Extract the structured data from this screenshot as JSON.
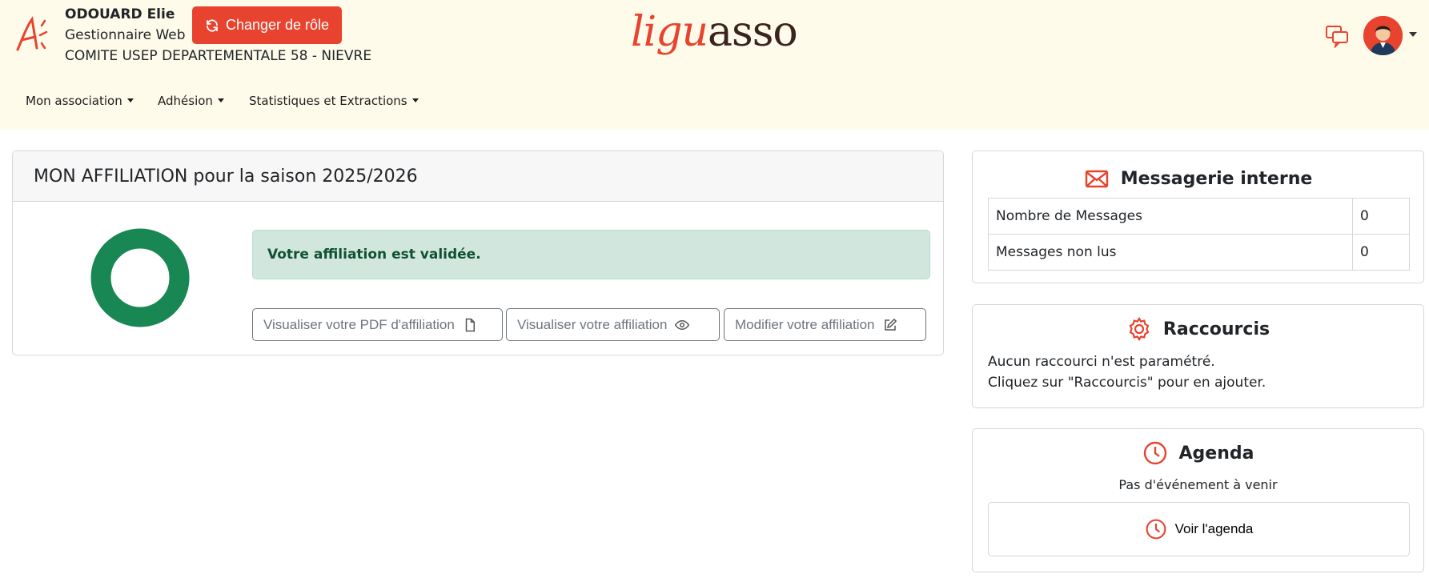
{
  "user": {
    "name": "ODOUARD Elie",
    "role": "Gestionnaire Web",
    "organization": "COMITE USEP DEPARTEMENTALE 58 - NIEVRE"
  },
  "header": {
    "change_role_label": "Changer de rôle",
    "brand_part1": "ligu",
    "brand_part2": "asso",
    "chat_icon": "chat-bubbles-icon",
    "avatar_icon": "user-avatar"
  },
  "nav": {
    "items": [
      {
        "label": "Mon association"
      },
      {
        "label": "Adhésion"
      },
      {
        "label": "Statistiques et Extractions"
      }
    ]
  },
  "affiliation": {
    "title": "MON AFFILIATION pour la saison 2025/2026",
    "status_message": "Votre affiliation est validée.",
    "progress": 1.0,
    "progress_color": "#198754",
    "buttons": {
      "pdf": "Visualiser votre PDF d'affiliation",
      "view": "Visualiser votre affiliation",
      "edit": "Modifier votre affiliation"
    }
  },
  "messaging": {
    "title": "Messagerie interne",
    "rows": [
      {
        "label": "Nombre de Messages",
        "value": "0"
      },
      {
        "label": "Messages non lus",
        "value": "0"
      }
    ]
  },
  "shortcuts": {
    "title": "Raccourcis",
    "line1": "Aucun raccourci n'est paramétré.",
    "line2": "Cliquez sur \"Raccourcis\" pour en ajouter."
  },
  "agenda": {
    "title": "Agenda",
    "empty_text": "Pas d'événement à venir",
    "button_label": "Voir l'agenda"
  },
  "colors": {
    "accent": "#e8432e",
    "header_bg": "#fffbea",
    "success_bg": "#d1e7dd",
    "success_text": "#0f5132"
  }
}
